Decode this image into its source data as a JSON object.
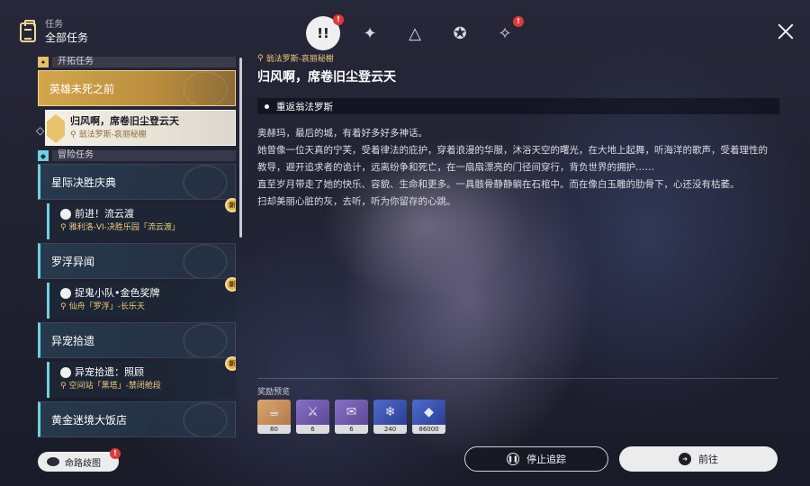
{
  "header": {
    "section_label": "任务",
    "title": "全部任务",
    "tabs": [
      {
        "icon": "quest-alert-icon",
        "glyph": "!!",
        "badge": "!"
      },
      {
        "icon": "star-compass-icon",
        "glyph": "✦",
        "badge": ""
      },
      {
        "icon": "triangle-emblem-icon",
        "glyph": "△",
        "badge": ""
      },
      {
        "icon": "star-emblem-icon",
        "glyph": "✪",
        "badge": ""
      },
      {
        "icon": "diamond-star-icon",
        "glyph": "✧",
        "badge": "!"
      }
    ]
  },
  "quest_list": {
    "trailblaze_category": "开拓任务",
    "trailblaze_main": "英雄未死之前",
    "selected_quest": {
      "title": "归风啊，席卷旧尘登云天",
      "location": "翁法罗斯-哀丽秘榭"
    },
    "adventure_category": "冒险任务",
    "adventure_groups": [
      {
        "title": "星际决胜庆典",
        "sub_title": "前进！流云渡",
        "sub_location": "雅利洛-VI-决胜乐园「流云渡」",
        "new": "新"
      },
      {
        "title": "罗浮异闻",
        "sub_title": "捉鬼小队•金色奖牌",
        "sub_location": "仙舟「罗浮」-长乐天",
        "new": "新"
      },
      {
        "title": "异宠拾遗",
        "sub_title": "异宠拾遗：照顾",
        "sub_location": "空间站「黑塔」-禁闭舱段",
        "new": "新"
      },
      {
        "title": "黄金迷境大饭店"
      }
    ]
  },
  "astral_button": {
    "label": "命路歧图",
    "badge": "!"
  },
  "detail": {
    "location": "翁法罗斯-哀丽秘榭",
    "title": "归风啊，席卷旧尘登云天",
    "objective": "重返翁法罗斯",
    "description": [
      "奥赫玛，最后的城，有着好多好多神话。",
      "她曾像一位天真的宁芙，受着律法的庇护，穿着浪漫的华服，沐浴天空的曙光，在大地上起舞，听海洋的歌声，受着理性的教导，避开追求者的诡计，远离纷争和死亡，在一扇扇漂亮的门径间穿行，背负世界的拥护……",
      "直至岁月带走了她的快乐、容貌、生命和更多。一具骸骨静静躺在石棺中。而在像白玉雕的肋骨下，心还没有枯萎。",
      "扫却美丽心脏的灰，去听，听为你留存的心跳。"
    ]
  },
  "rewards": {
    "title": "奖励预览",
    "items": [
      {
        "icon": "hotpot-item-icon",
        "count": "80",
        "rarity": "gold"
      },
      {
        "icon": "weapon-material-icon",
        "count": "6",
        "rarity": "purple"
      },
      {
        "icon": "scroll-material-icon",
        "count": "6",
        "rarity": "purple"
      },
      {
        "icon": "crystal-material-icon",
        "count": "240",
        "rarity": "blue"
      },
      {
        "icon": "credit-pouch-icon",
        "count": "86000",
        "rarity": "blue"
      }
    ]
  },
  "actions": {
    "stop_label": "停止追踪",
    "go_label": "前往"
  }
}
